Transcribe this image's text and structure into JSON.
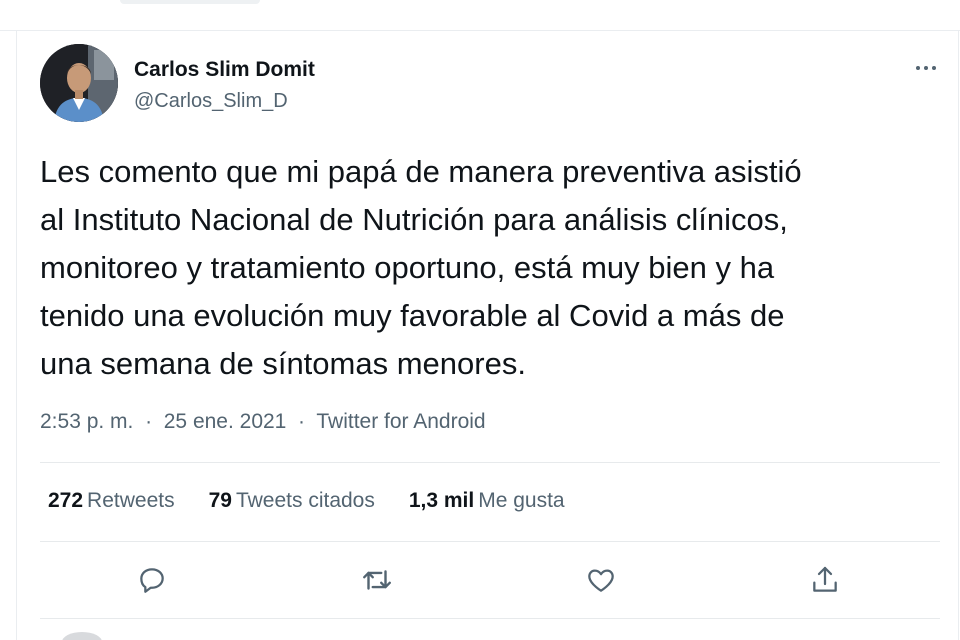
{
  "tweet": {
    "author_name": "Carlos Slim Domit",
    "author_handle": "@Carlos_Slim_D",
    "text_lines": [
      "Les comento que mi papá de manera preventiva asistió",
      "al Instituto Nacional de Nutrición para análisis clínicos,",
      "monitoreo y tratamiento oportuno, está muy bien y ha",
      "tenido una evolución muy favorable al Covid a más de",
      "una semana de síntomas menores."
    ],
    "time": "2:53 p. m.",
    "separator": "·",
    "date": "25 ene. 2021",
    "source": "Twitter for Android"
  },
  "stats": {
    "retweets_count": "272",
    "retweets_label": "Retweets",
    "quotes_count": "79",
    "quotes_label": "Tweets citados",
    "likes_count": "1,3 mil",
    "likes_label": "Me gusta"
  },
  "actions": {
    "reply": "reply-icon",
    "retweet": "retweet-icon",
    "like": "heart-icon",
    "share": "share-icon"
  },
  "colors": {
    "primary_text": "#0f1419",
    "secondary_text": "#536471",
    "divider": "#e7eaec"
  }
}
